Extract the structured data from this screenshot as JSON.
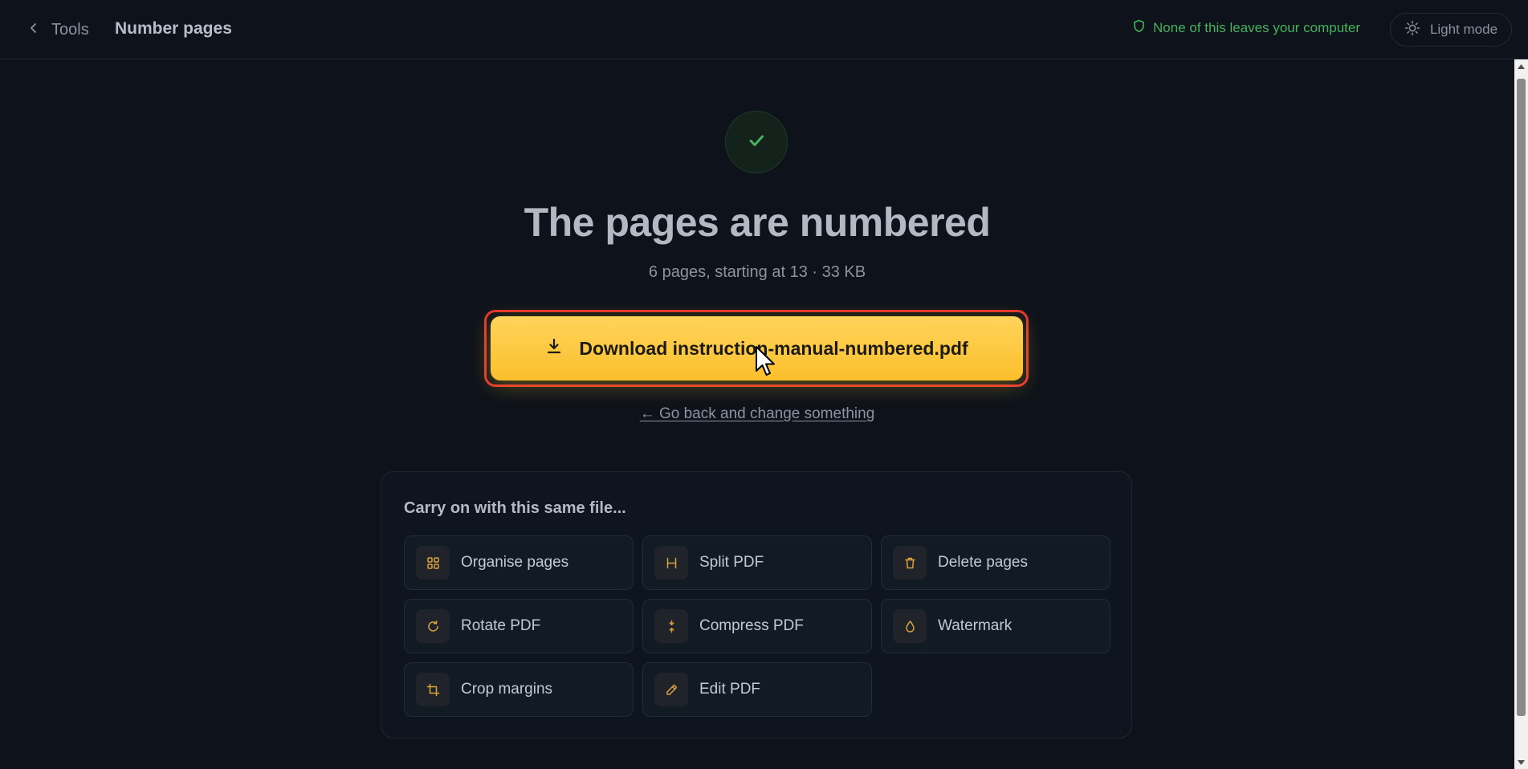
{
  "header": {
    "back_label": "Tools",
    "title": "Number pages",
    "privacy_note": "None of this leaves your computer",
    "theme_toggle_label": "Light mode"
  },
  "result": {
    "headline": "The pages are numbered",
    "summary": "6 pages, starting at 13 · 33 KB",
    "download_label": "Download instruction-manual-numbered.pdf",
    "go_back_label": "← Go back and change something"
  },
  "carry_on": {
    "title": "Carry on with this same file...",
    "tools": [
      {
        "label": "Organise pages",
        "icon": "grid-icon"
      },
      {
        "label": "Split PDF",
        "icon": "split-icon"
      },
      {
        "label": "Delete pages",
        "icon": "trash-icon"
      },
      {
        "label": "Rotate PDF",
        "icon": "rotate-icon"
      },
      {
        "label": "Compress PDF",
        "icon": "compress-icon"
      },
      {
        "label": "Watermark",
        "icon": "droplet-icon"
      },
      {
        "label": "Crop margins",
        "icon": "crop-icon"
      },
      {
        "label": "Edit PDF",
        "icon": "pencil-icon"
      }
    ]
  },
  "colors": {
    "background": "#0e131b",
    "accent": "#fbbf24",
    "success": "#46b25c",
    "focus_outline": "#e5332f"
  }
}
